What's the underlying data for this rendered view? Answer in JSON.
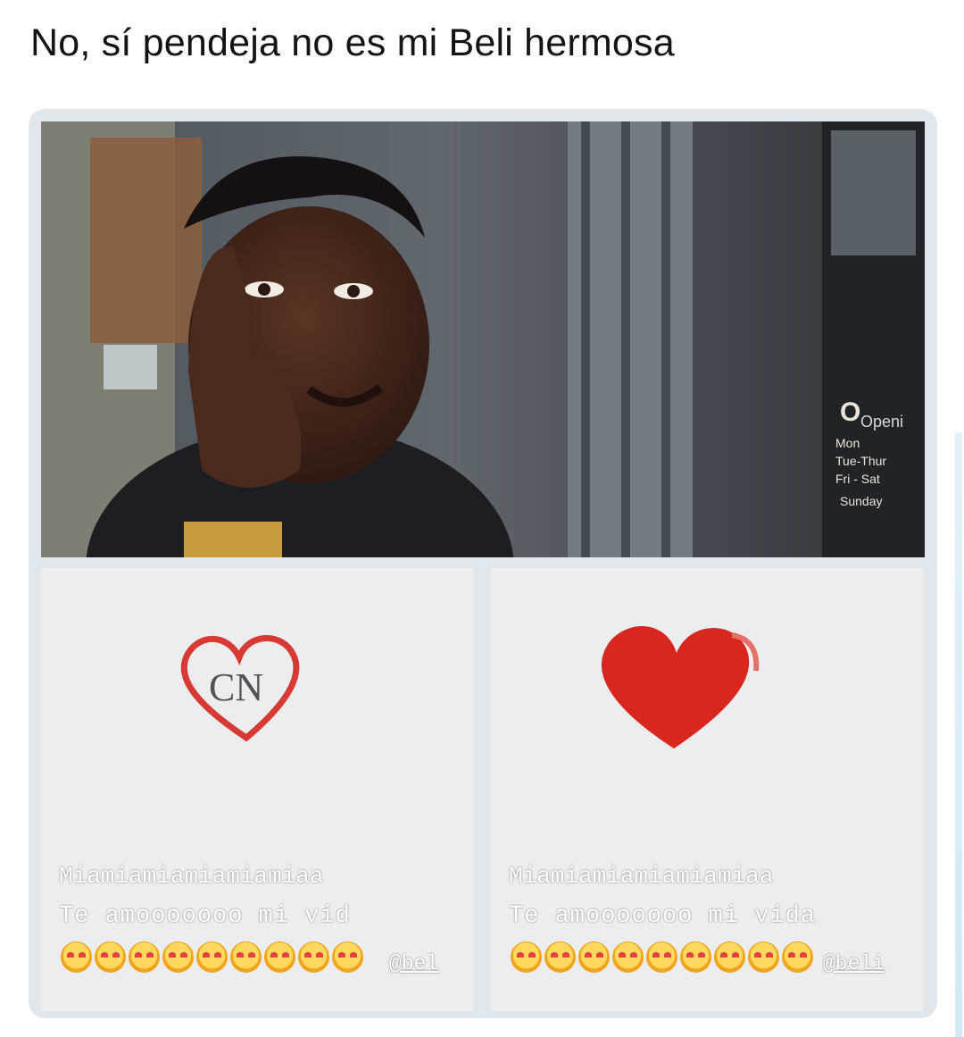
{
  "caption": "No, sí pendeja no es mi Beli hermosa",
  "meme": {
    "sign_top": "Openi",
    "sign_lines": [
      "Mon",
      "Tue-Thur",
      "Fri - Sat",
      "Sunday"
    ]
  },
  "panels": [
    {
      "heart_text": "CN",
      "line1": "Miamiamiamiamiamiaa",
      "line2": "Te amooooooo mi vid",
      "emoji_count": 9,
      "mention": "@bel"
    },
    {
      "heart_text": "",
      "line1": "Miamiamiamiamiamiaa",
      "line2": "Te amooooooo mi vida",
      "emoji_count": 9,
      "mention": "@beli"
    }
  ],
  "colors": {
    "heart": "#d9261f",
    "heart_outline": "#d63a33",
    "frame": "#dfe6ec"
  }
}
